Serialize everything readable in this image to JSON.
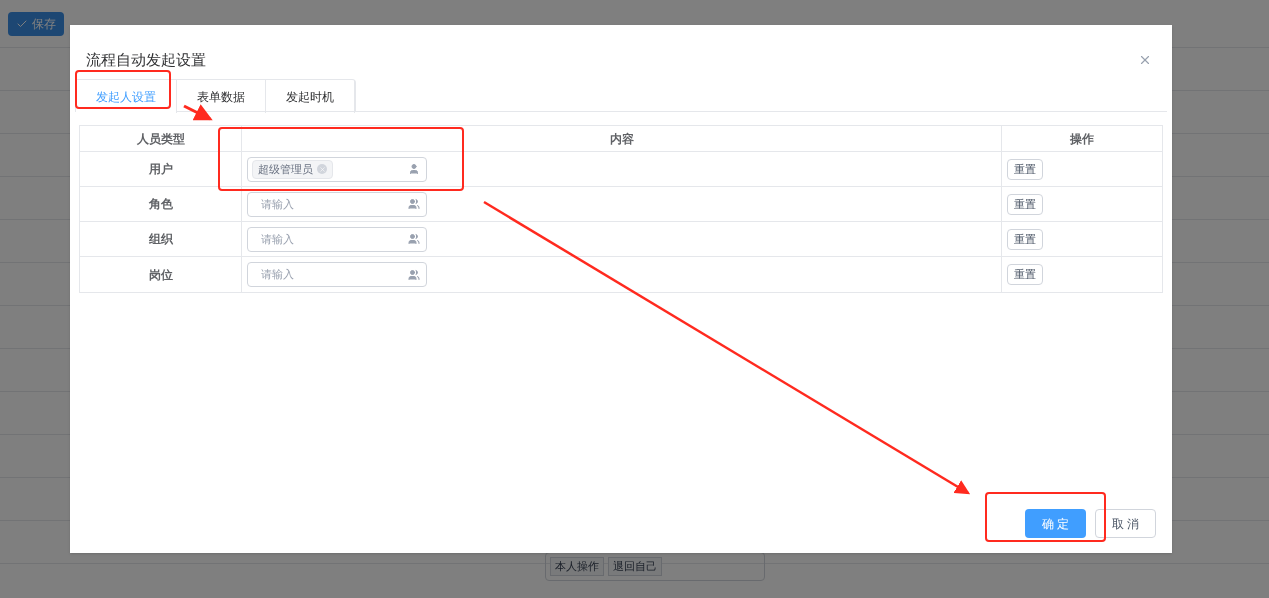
{
  "background_page": {
    "save_button": "保存",
    "tags": [
      {
        "label": "本人操作"
      },
      {
        "label": "退回自己"
      }
    ]
  },
  "dialog": {
    "title": "流程自动发起设置",
    "tabs": [
      {
        "label": "发起人设置",
        "selected": true
      },
      {
        "label": "表单数据",
        "selected": false
      },
      {
        "label": "发起时机",
        "selected": false
      }
    ],
    "table": {
      "columns": [
        "人员类型",
        "内容",
        "操作"
      ],
      "rows": [
        {
          "type": "用户",
          "tags": [
            "超级管理员"
          ],
          "kind": "user",
          "action": "重置"
        },
        {
          "type": "角色",
          "placeholder": "请输入",
          "kind": "group",
          "action": "重置"
        },
        {
          "type": "组织",
          "placeholder": "请输入",
          "kind": "group",
          "action": "重置"
        },
        {
          "type": "岗位",
          "placeholder": "请输入",
          "kind": "group",
          "action": "重置"
        }
      ]
    },
    "buttons": [
      {
        "label": "确 定",
        "kind": "primary"
      },
      {
        "label": "取 消",
        "kind": "default"
      }
    ]
  }
}
